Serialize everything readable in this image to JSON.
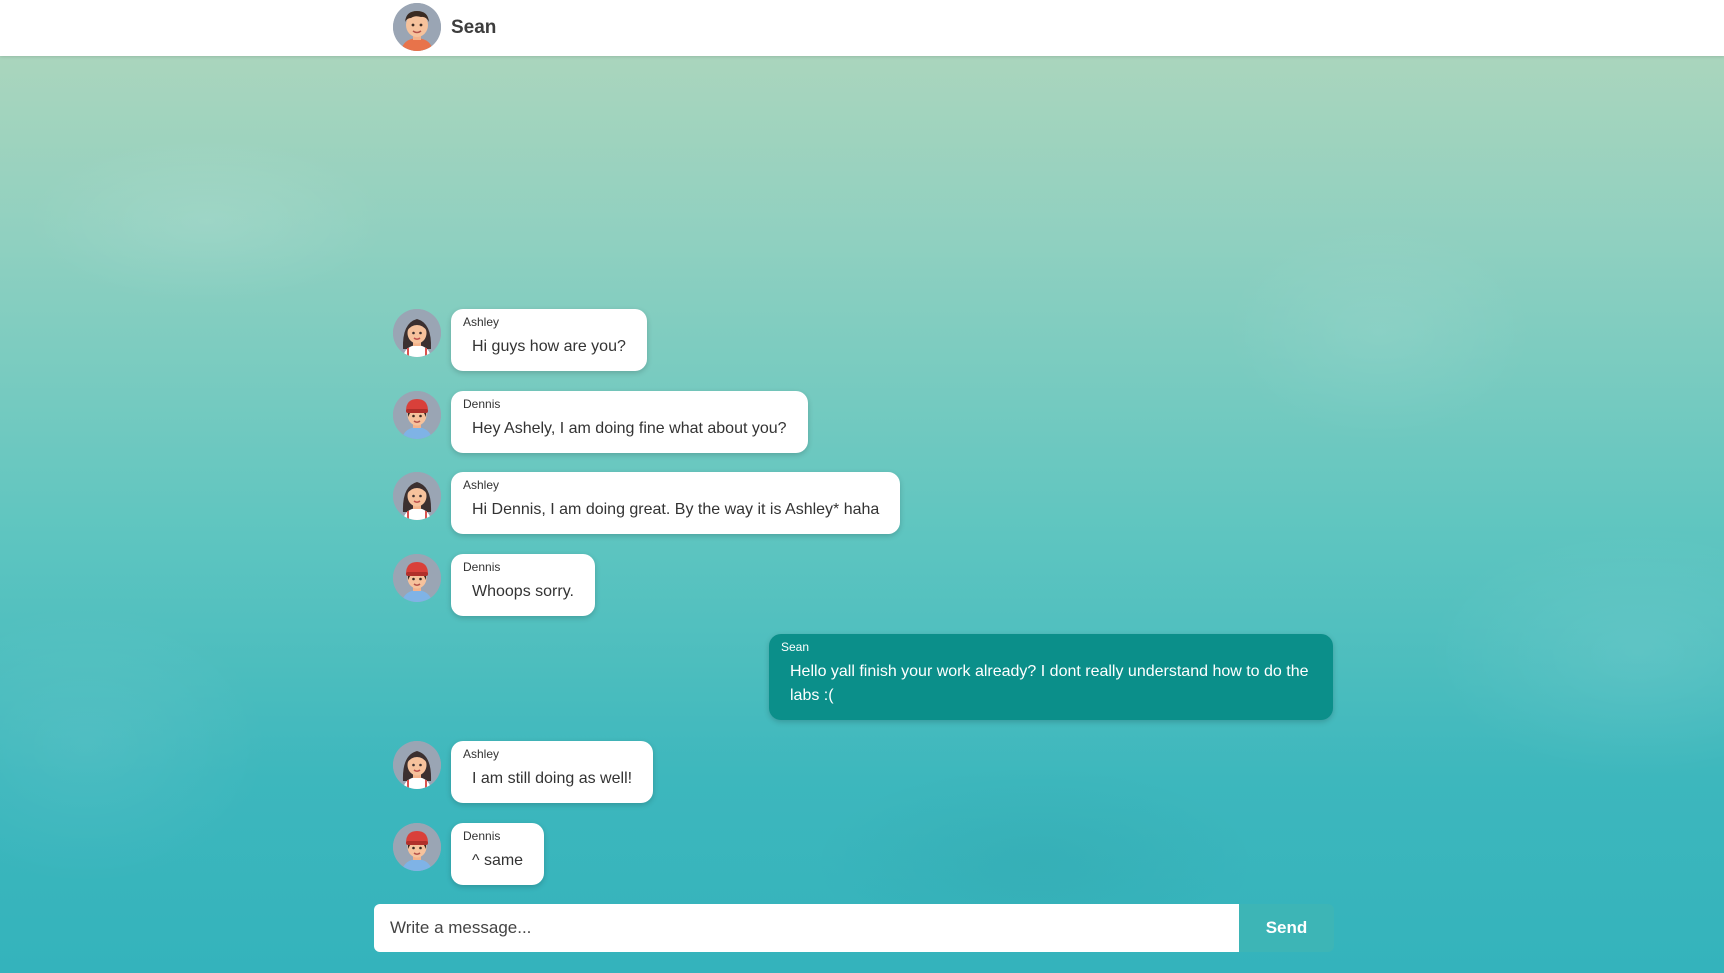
{
  "header": {
    "title": "Sean",
    "avatar_icon": "boy-avatar-icon"
  },
  "colors": {
    "own_bubble": "#0b8f8a",
    "send_button": "#3db5b6",
    "background_top": "#b2d7bc",
    "background_bottom": "#34b3bc"
  },
  "messages": [
    {
      "sender": "Ashley",
      "text": "Hi guys how are you?",
      "avatar_icon": "girl-avatar-icon",
      "own": false
    },
    {
      "sender": "Dennis",
      "text": "Hey Ashely, I am doing fine what about you?",
      "avatar_icon": "boy-cap-avatar-icon",
      "own": false
    },
    {
      "sender": "Ashley",
      "text": "Hi Dennis, I am doing great. By the way it is Ashley* haha",
      "avatar_icon": "girl-avatar-icon",
      "own": false
    },
    {
      "sender": "Dennis",
      "text": "Whoops sorry.",
      "avatar_icon": "boy-cap-avatar-icon",
      "own": false
    },
    {
      "sender": "Sean",
      "text": "Hello yall finish your work already? I dont really understand how to do the labs :(",
      "own": true
    },
    {
      "sender": "Ashley",
      "text": "I am still doing as well!",
      "avatar_icon": "girl-avatar-icon",
      "own": false
    },
    {
      "sender": "Dennis",
      "text": "^ same",
      "avatar_icon": "boy-cap-avatar-icon",
      "own": false
    }
  ],
  "composer": {
    "placeholder": "Write a message...",
    "value": "",
    "send_label": "Send"
  }
}
